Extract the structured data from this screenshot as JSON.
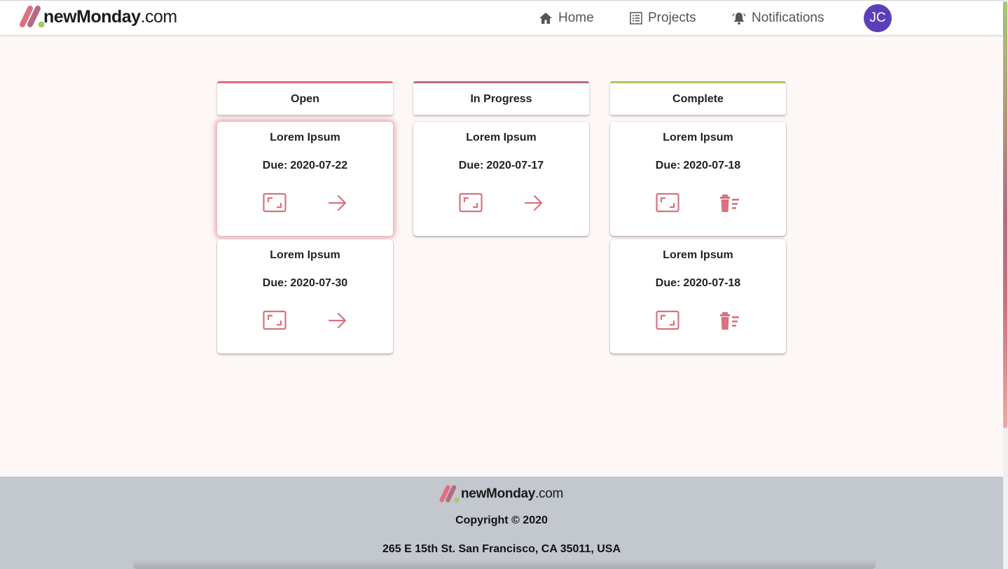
{
  "brand": {
    "name_bold": "newMonday",
    "name_suffix": ".com",
    "colors": {
      "pink": "#e0707c",
      "mauve": "#b56a84",
      "green": "#a6c963"
    }
  },
  "nav": {
    "items": [
      {
        "label": "Home",
        "icon": "home-icon"
      },
      {
        "label": "Projects",
        "icon": "list-icon"
      },
      {
        "label": "Notifications",
        "icon": "bell-icon"
      }
    ],
    "avatar_initials": "JC",
    "avatar_color": "#5b3fb8"
  },
  "board": {
    "columns": [
      {
        "title": "Open",
        "accent": "#e0707c",
        "cards": [
          {
            "title": "Lorem Ipsum",
            "due_label": "Due:",
            "due_date": "2020-07-22",
            "action": "move-forward",
            "action_icon": "arrow-right-icon",
            "selected": true
          },
          {
            "title": "Lorem Ipsum",
            "due_label": "Due:",
            "due_date": "2020-07-30",
            "action": "move-forward",
            "action_icon": "arrow-right-icon"
          }
        ]
      },
      {
        "title": "In Progress",
        "accent": "#b56a84",
        "cards": [
          {
            "title": "Lorem Ipsum",
            "due_label": "Due:",
            "due_date": "2020-07-17",
            "action": "move-forward",
            "action_icon": "arrow-right-icon"
          }
        ]
      },
      {
        "title": "Complete",
        "accent": "#a6c963",
        "cards": [
          {
            "title": "Lorem Ipsum",
            "due_label": "Due:",
            "due_date": "2020-07-18",
            "action": "delete",
            "action_icon": "trash-icon"
          },
          {
            "title": "Lorem Ipsum",
            "due_label": "Due:",
            "due_date": "2020-07-18",
            "action": "delete",
            "action_icon": "trash-icon"
          }
        ]
      }
    ],
    "icon_color": "#d8727e"
  },
  "footer": {
    "copyright": "Copyright © 2020",
    "address": "265 E 15th St. San Francisco, CA 35011, USA"
  }
}
